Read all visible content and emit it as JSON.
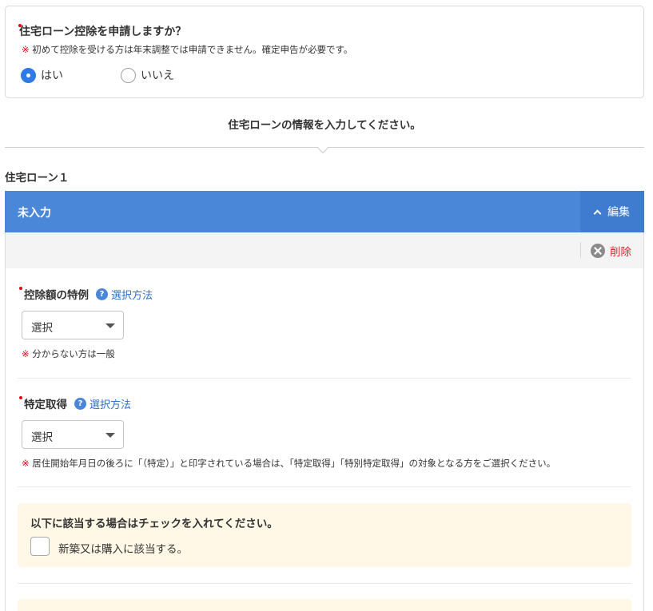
{
  "question": {
    "title": "住宅ローン控除を申請しますか？",
    "note_mark": "※",
    "note": "初めて控除を受ける方は年末調整では申請できません。確定申告が必要です。",
    "options": [
      {
        "label": "はい",
        "selected": true
      },
      {
        "label": "いいえ",
        "selected": false
      }
    ]
  },
  "section": {
    "heading": "住宅ローンの情報を入力してください。"
  },
  "loan": {
    "title": "住宅ローン１",
    "status": "未入力",
    "edit_label": "編集",
    "delete_label": "削除",
    "fields": [
      {
        "label": "控除額の特例",
        "help_link": "選択方法",
        "select_value": "選択",
        "note_mark": "※",
        "note": "分からない方は一般"
      },
      {
        "label": "特定取得",
        "help_link": "選択方法",
        "select_value": "選択",
        "note_mark": "※",
        "note": "居住開始年月日の後ろに「（特定）」と印字されている場合は、「特定取得」「特別特定取得」の対象となる方をご選択ください。"
      }
    ],
    "check_section": {
      "title": "以下に該当する場合はチェックを入れてください。",
      "checkbox_label": "新築又は購入に該当する。",
      "checked": false
    }
  },
  "colors": {
    "accent": "#4a87d9",
    "required": "#e60012",
    "danger": "#d9272e",
    "highlight_bg": "#fff8e6"
  },
  "icons": [
    "help-icon",
    "close-circle-icon",
    "chevron-up-icon",
    "chevron-down-icon"
  ]
}
